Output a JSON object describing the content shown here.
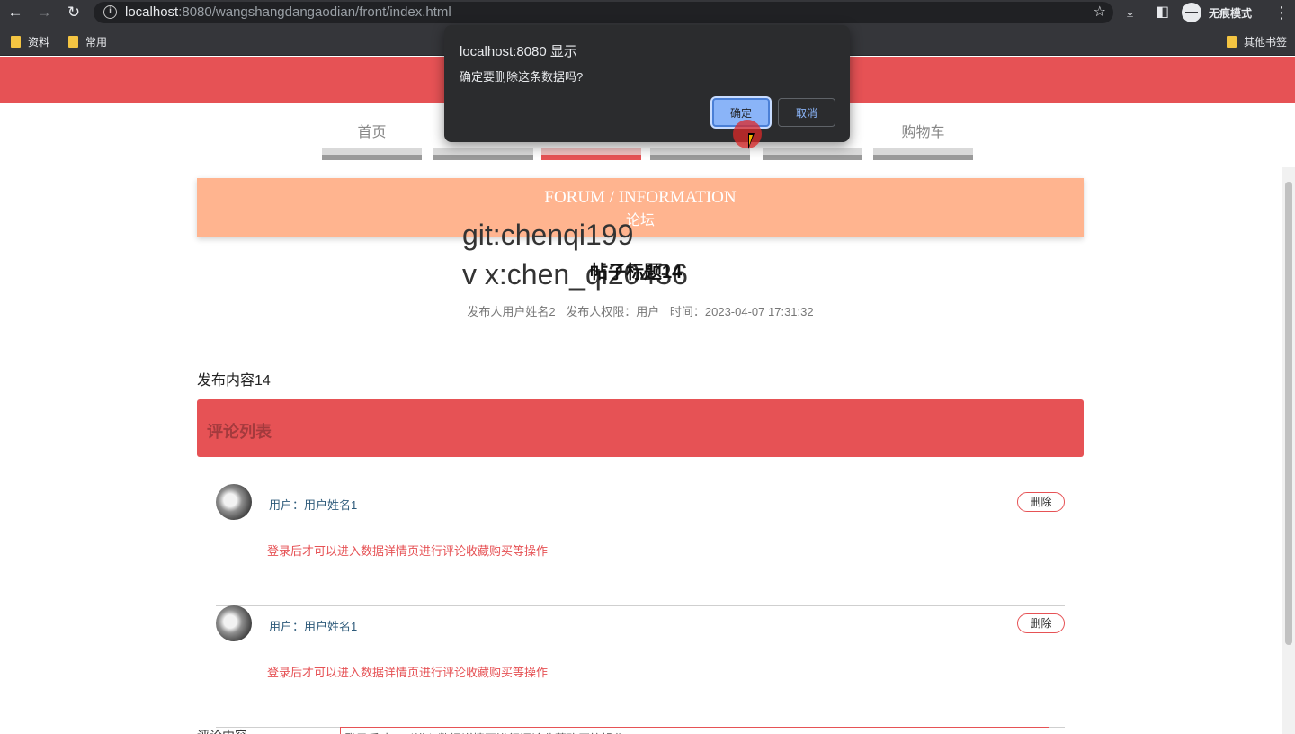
{
  "browser": {
    "url_host": "localhost",
    "url_rest": ":8080/wangshangdangaodian/front/index.html",
    "incognito_label": "无痕模式",
    "bookmarks": [
      "资料",
      "常用"
    ],
    "other_bookmarks": "其他书签",
    "icons": [
      "back-arrow-icon",
      "forward-arrow-icon",
      "reload-icon",
      "info-icon",
      "star-icon",
      "download-icon",
      "sidebar-icon",
      "incognito-icon",
      "kebab-menu-icon"
    ]
  },
  "dialog": {
    "title": "localhost:8080 显示",
    "message": "确定要删除这条数据吗?",
    "ok_label": "确定",
    "cancel_label": "取消"
  },
  "nav": {
    "first": "首页",
    "last": "购物车",
    "active_index": 2
  },
  "banner": {
    "en": "FORUM / INFORMATION",
    "zh": "论坛"
  },
  "watermark": {
    "line1": "git:chenqi199",
    "line2": "v x:chen_qi20436"
  },
  "post": {
    "title": "帖子标题14",
    "author": "发布人用户姓名2",
    "role": "发布人权限：用户",
    "time": "时间：2023-04-07 17:31:32",
    "content": "发布内容14"
  },
  "comments_header": "评论列表",
  "comments": [
    {
      "user": "用户：用户姓名1",
      "text": "登录后才可以进入数据详情页进行评论收藏购买等操作",
      "delete_label": "删除"
    },
    {
      "user": "用户：用户姓名1",
      "text": "登录后才可以进入数据详情页进行评论收藏购买等操作",
      "delete_label": "删除"
    }
  ],
  "form": {
    "label": "评论内容",
    "value": "登录后才可以进入数据详情页进行评论收藏购买等操作"
  },
  "colors": {
    "brand_red": "#e65255",
    "banner_orange": "#ffb48f",
    "chrome_dark": "#35363a"
  }
}
